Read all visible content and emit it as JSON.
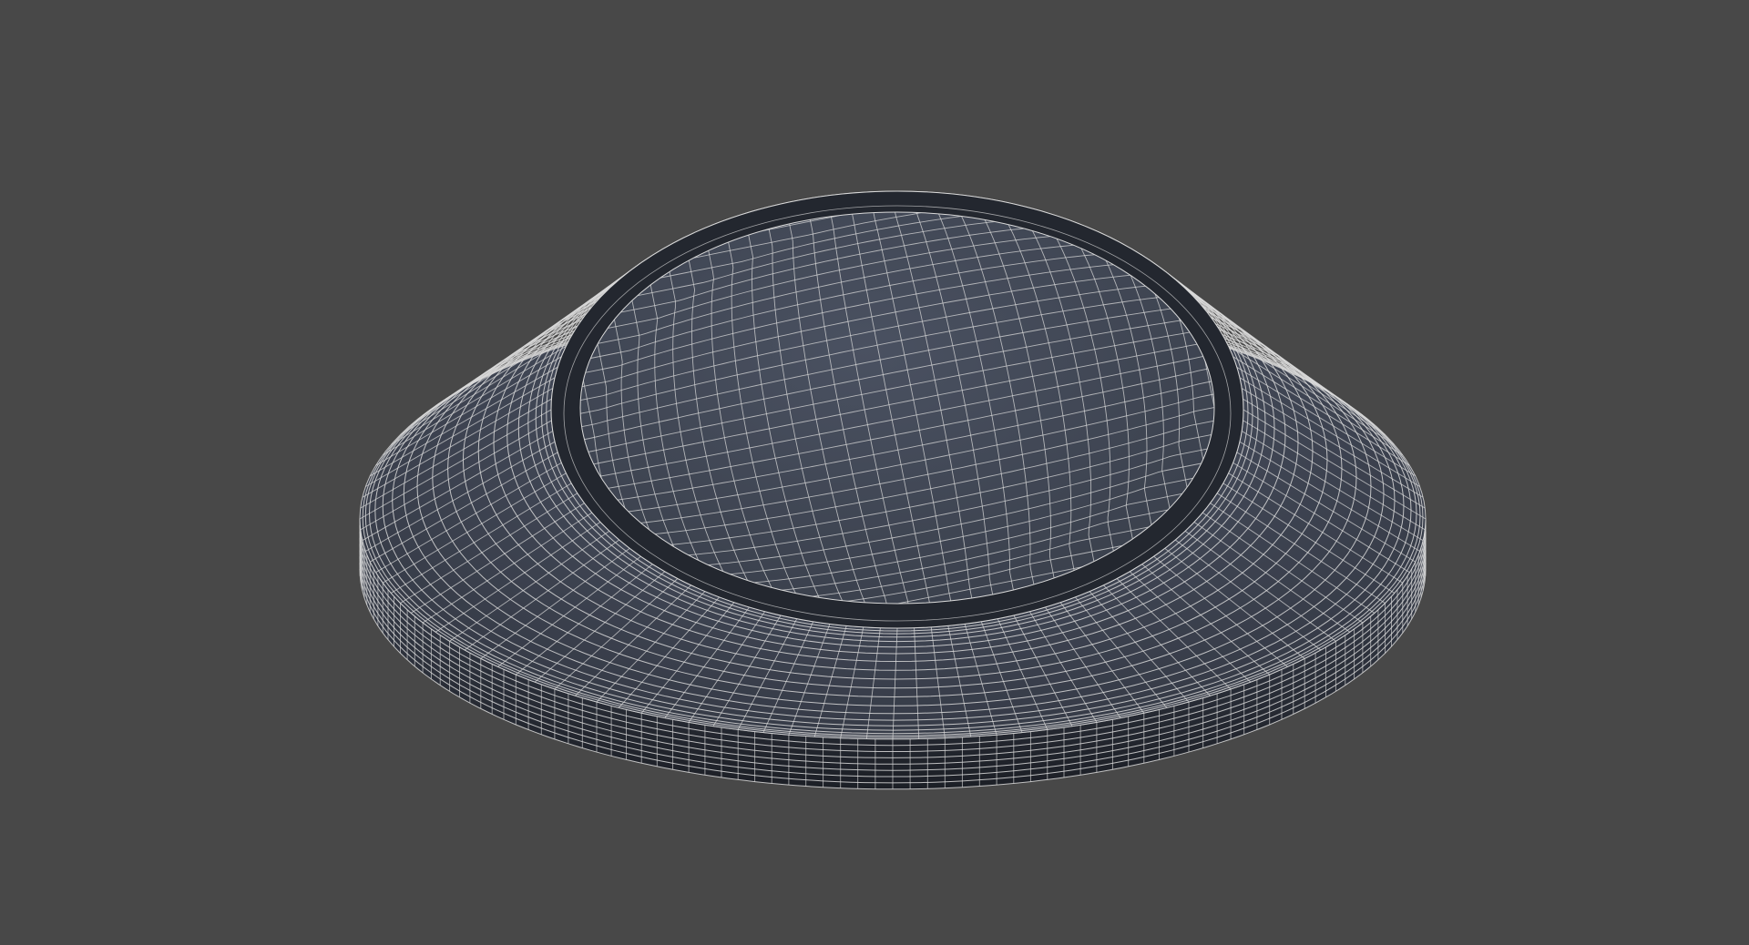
{
  "viewport": {
    "background_color": "#484848",
    "render_mode": "wireframe-on-shaded",
    "object": {
      "shape": "torus-rim-with-domed-center",
      "surface_color": "#3e4452",
      "surface_highlight_color": "#5a6272",
      "wire_color": "#d9d9d9"
    }
  }
}
